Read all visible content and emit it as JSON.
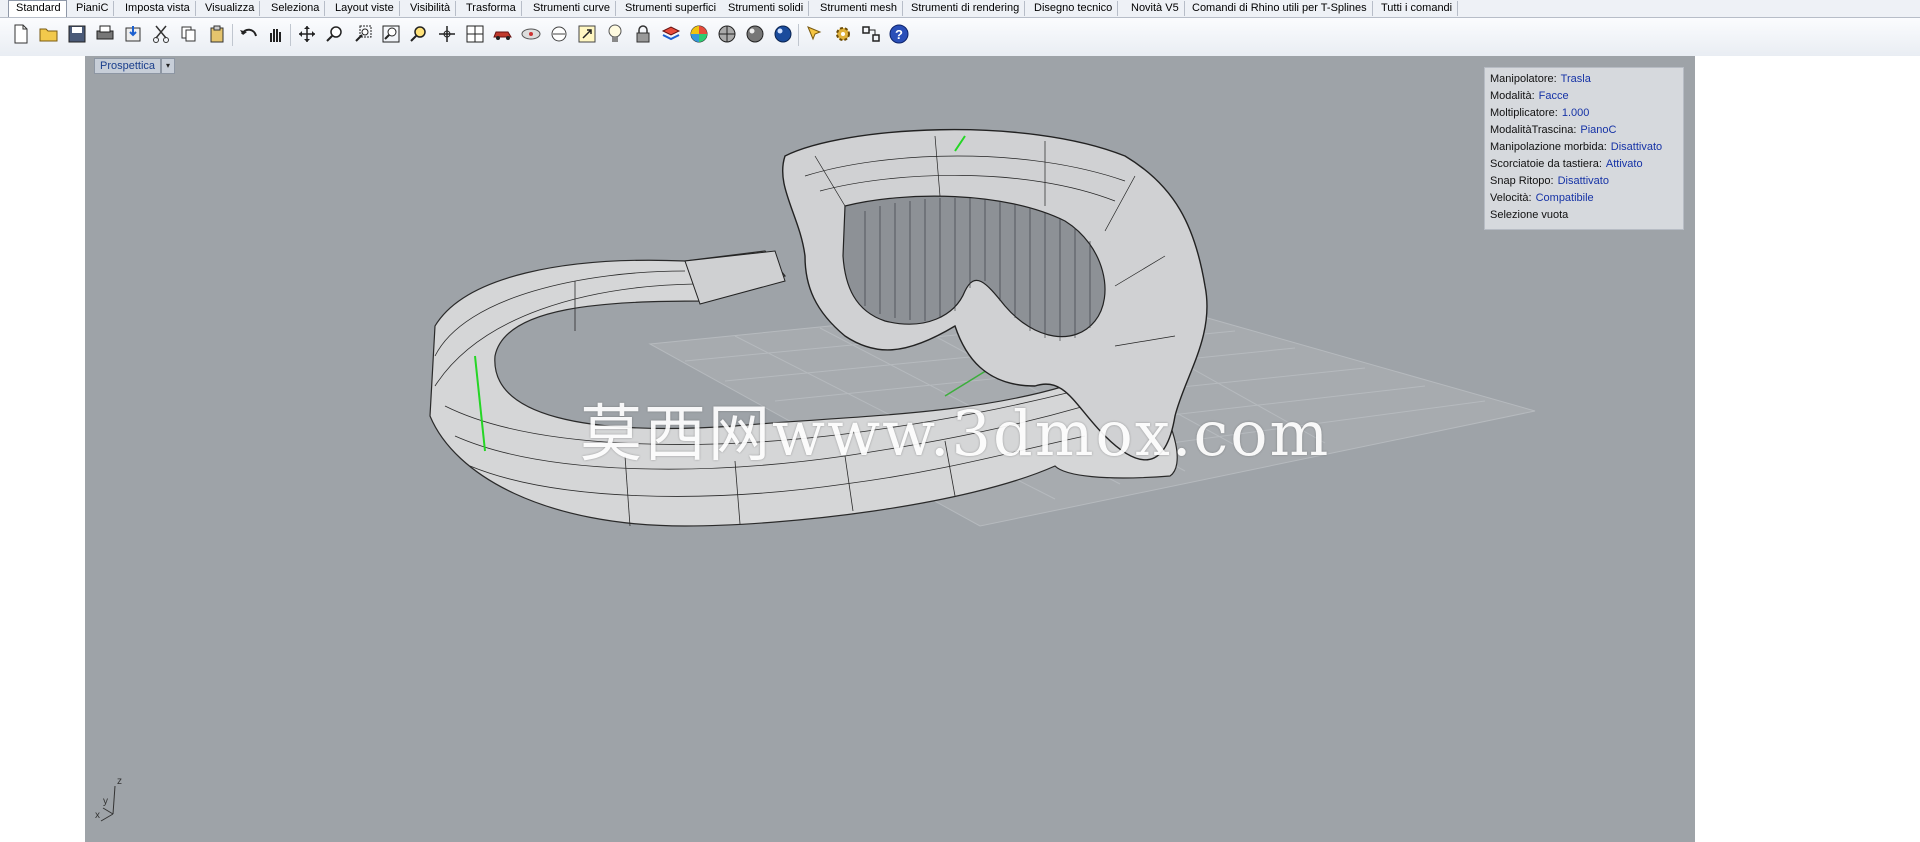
{
  "tabs": [
    "Standard",
    "PianiC",
    "Imposta vista",
    "Visualizza",
    "Seleziona",
    "Layout viste",
    "Visibilità",
    "Trasforma",
    "Strumenti curve",
    "Strumenti superfici",
    "Strumenti solidi",
    "Strumenti mesh",
    "Strumenti di rendering",
    "Disegno tecnico",
    "Novità V5",
    "Comandi di Rhino utili per T-Splines",
    "Tutti i comandi"
  ],
  "active_tab": "Standard",
  "toolbar_icons": [
    "new-file-icon",
    "open-file-icon",
    "save-icon",
    "print-icon",
    "import-icon",
    "cut-icon",
    "copy-icon",
    "paste-icon",
    "undo-icon",
    "pan-hand-icon",
    "move-view-icon",
    "zoom-icon",
    "zoom-window-icon",
    "zoom-extents-icon",
    "zoom-selected-icon",
    "rotate-view-icon",
    "four-viewports-icon",
    "car-icon",
    "hide-icon",
    "show-icon",
    "lock-icon",
    "move-icon",
    "lightbulb-icon",
    "lock-small-icon",
    "layer-icon",
    "color-wheel-icon",
    "sphere-shaded-icon",
    "sphere-render-icon",
    "sphere-blue-icon",
    "cursor-icon",
    "gear-icon",
    "command-icon",
    "help-icon"
  ],
  "viewport": {
    "title": "Prospettica",
    "menu_arrow": "▾"
  },
  "gumball_panel": {
    "rows": [
      {
        "label": "Manipolatore:",
        "value": "Trasla"
      },
      {
        "label": "Modalità:",
        "value": "Facce"
      },
      {
        "label": "Moltiplicatore:",
        "value": "1.000"
      },
      {
        "label": "ModalitàTrascina:",
        "value": "PianoC"
      },
      {
        "label": "Manipolazione morbida:",
        "value": "Disattivato"
      },
      {
        "label": "Scorciatoie da tastiera:",
        "value": "Attivato"
      },
      {
        "label": "Snap Ritopo:",
        "value": "Disattivato"
      },
      {
        "label": "Velocità:",
        "value": "Compatibile"
      },
      {
        "label": "Selezione vuota",
        "value": ""
      }
    ]
  },
  "watermark": "莫西网www.3dmox.com",
  "axes": {
    "z": "z",
    "y": "y",
    "x": "x"
  },
  "colors": {
    "viewport_bg": "#9ea3a8",
    "panel_bg": "#d6d9dd",
    "value_text": "#1633a6"
  }
}
